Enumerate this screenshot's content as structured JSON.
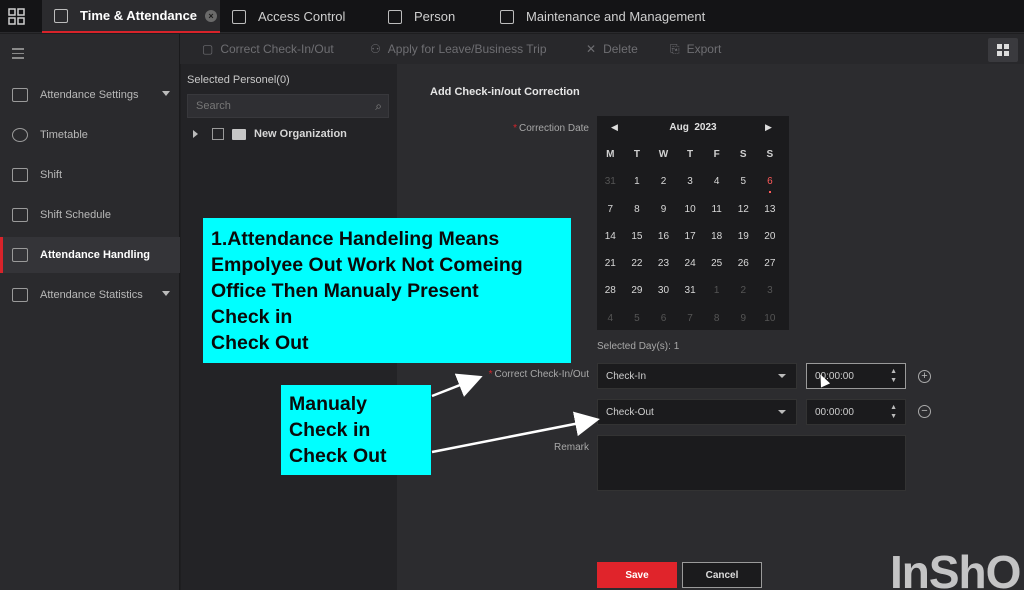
{
  "tabs": [
    {
      "label": "Time & Attendance",
      "active": true
    },
    {
      "label": "Access Control"
    },
    {
      "label": "Person"
    },
    {
      "label": "Maintenance and Management"
    }
  ],
  "toolbar": {
    "correct": "Correct Check-In/Out",
    "leave": "Apply for Leave/Business Trip",
    "delete": "Delete",
    "export": "Export"
  },
  "sidebar": {
    "items": [
      {
        "label": "Attendance Settings"
      },
      {
        "label": "Timetable"
      },
      {
        "label": "Shift"
      },
      {
        "label": "Shift Schedule"
      },
      {
        "label": "Attendance Handling"
      },
      {
        "label": "Attendance Statistics"
      }
    ]
  },
  "personnel": {
    "title": "Selected Personel(0)",
    "search_placeholder": "Search",
    "org": "New Organization"
  },
  "form": {
    "title": "Add Check-in/out Correction",
    "date_label": "Correction Date",
    "checkinout_label": "Correct Check-In/Out",
    "remark_label": "Remark",
    "selected_days": "Selected Day(s): 1",
    "row1_type": "Check-In",
    "row1_time": "00:00:00",
    "row2_type": "Check-Out",
    "row2_time": "00:00:00",
    "save": "Save",
    "cancel": "Cancel"
  },
  "calendar": {
    "month": "Aug",
    "year": "2023",
    "dow": [
      "M",
      "T",
      "W",
      "T",
      "F",
      "S",
      "S"
    ],
    "days": [
      "31",
      "1",
      "2",
      "3",
      "4",
      "5",
      "6",
      "7",
      "8",
      "9",
      "10",
      "11",
      "12",
      "13",
      "14",
      "15",
      "16",
      "17",
      "18",
      "19",
      "20",
      "21",
      "22",
      "23",
      "24",
      "25",
      "26",
      "27",
      "28",
      "29",
      "30",
      "31",
      "1",
      "2",
      "3",
      "4",
      "5",
      "6",
      "7",
      "8",
      "9",
      "10"
    ],
    "selected": "6"
  },
  "annotations": {
    "callout1": [
      "1.Attendance Handeling Means",
      "Empolyee Out Work Not Comeing",
      "Office Then Manualy Present",
      "Check in",
      "Check Out"
    ],
    "callout2": [
      "Manualy",
      "Check in",
      "Check Out"
    ]
  },
  "watermark": "InShO",
  "colors": {
    "accent": "#d8232a",
    "callout": "#00ffff"
  }
}
